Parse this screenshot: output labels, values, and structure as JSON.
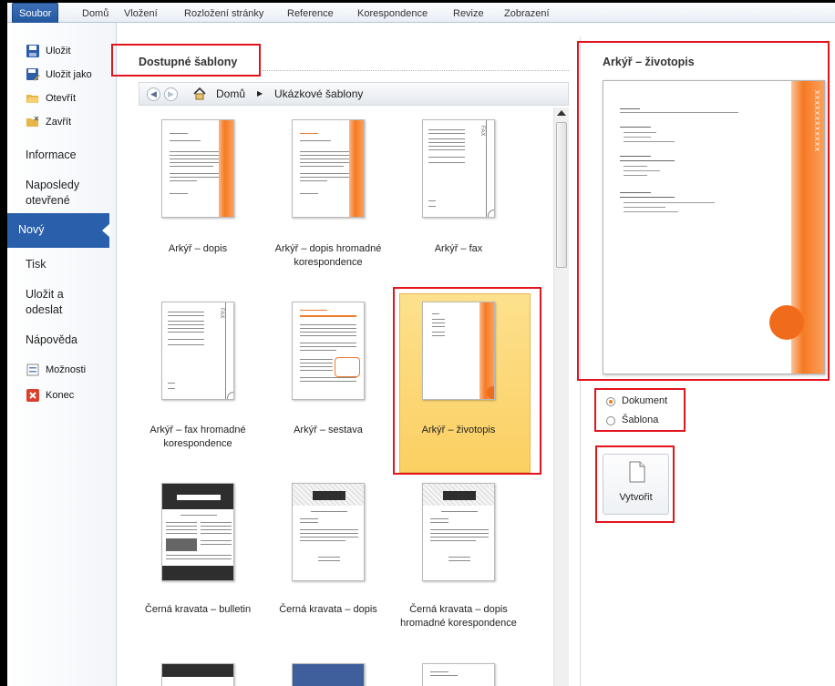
{
  "ribbon": {
    "tabs": [
      "Soubor",
      "Domů",
      "Vložení",
      "Rozložení stránky",
      "Reference",
      "Korespondence",
      "Revize",
      "Zobrazení"
    ]
  },
  "nav": {
    "save": "Uložit",
    "save_as": "Uložit jako",
    "open": "Otevřít",
    "close": "Zavřít",
    "info": "Informace",
    "recent_1": "Naposledy",
    "recent_2": "otevřené",
    "new": "Nový",
    "print": "Tisk",
    "send_1": "Uložit a",
    "send_2": "odeslat",
    "help": "Nápověda",
    "options": "Možnosti",
    "exit": "Konec"
  },
  "templates": {
    "heading": "Dostupné šablony",
    "breadcrumb": {
      "home": "Domů",
      "current": "Ukázkové šablony"
    },
    "items": [
      {
        "label": "Arkýř – dopis"
      },
      {
        "label": "Arkýř – dopis hromadné korespondence"
      },
      {
        "label": "Arkýř – fax"
      },
      {
        "label": "Arkýř – fax hromadné korespondence"
      },
      {
        "label": "Arkýř – sestava"
      },
      {
        "label": "Arkýř – životopis",
        "selected": true
      },
      {
        "label": "Černá kravata – bulletin"
      },
      {
        "label": "Černá kravata – dopis"
      },
      {
        "label": "Černá kravata – dopis hromadné korespondence"
      }
    ]
  },
  "preview": {
    "title": "Arkýř – životopis",
    "option_document": "Dokument",
    "option_template": "Šablona",
    "selected_option": "Dokument",
    "create": "Vytvořit"
  },
  "colors": {
    "accent": "#2a5fab",
    "selection": "#fcd57a",
    "highlight_box": "#e3141c",
    "template_orange": "#f57a22"
  }
}
